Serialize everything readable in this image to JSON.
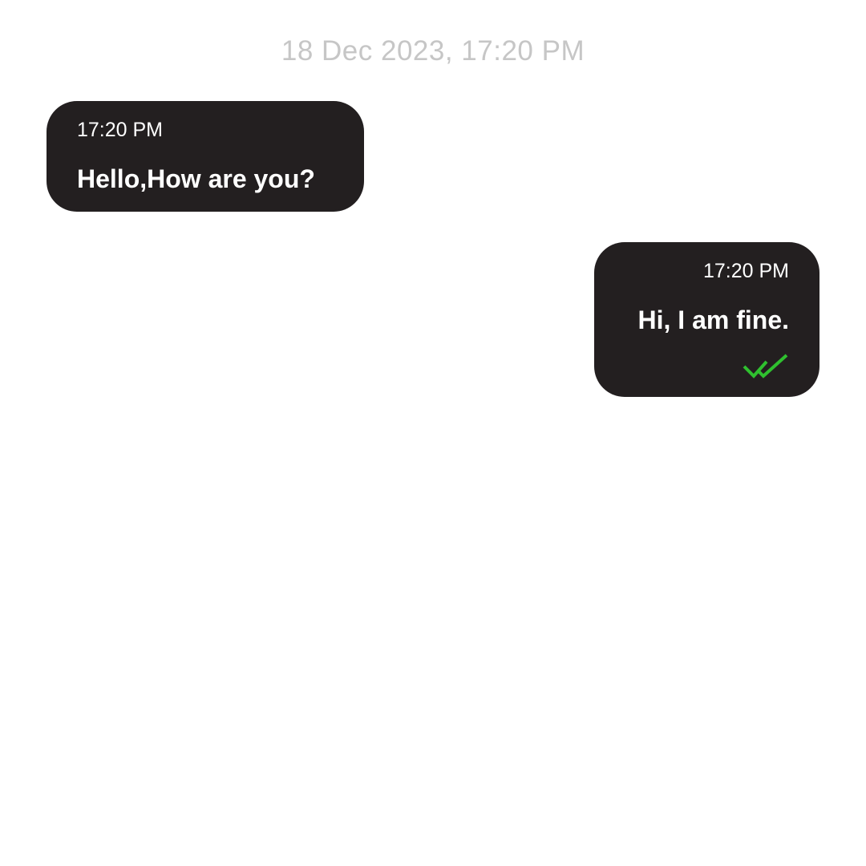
{
  "conversation": {
    "date_divider": "18 Dec 2023, 17:20 PM",
    "messages": [
      {
        "direction": "incoming",
        "time": "17:20 PM",
        "text": "Hello,How are you?"
      },
      {
        "direction": "outgoing",
        "time": "17:20 PM",
        "text": "Hi, I am fine.",
        "read_receipt_icon": "double-check-icon",
        "read_receipt_color": "#2fc02f"
      }
    ]
  },
  "colors": {
    "bubble": "#231f20",
    "bubble_text": "#ffffff",
    "date_text": "#c6c6c6",
    "background": "#ffffff"
  }
}
